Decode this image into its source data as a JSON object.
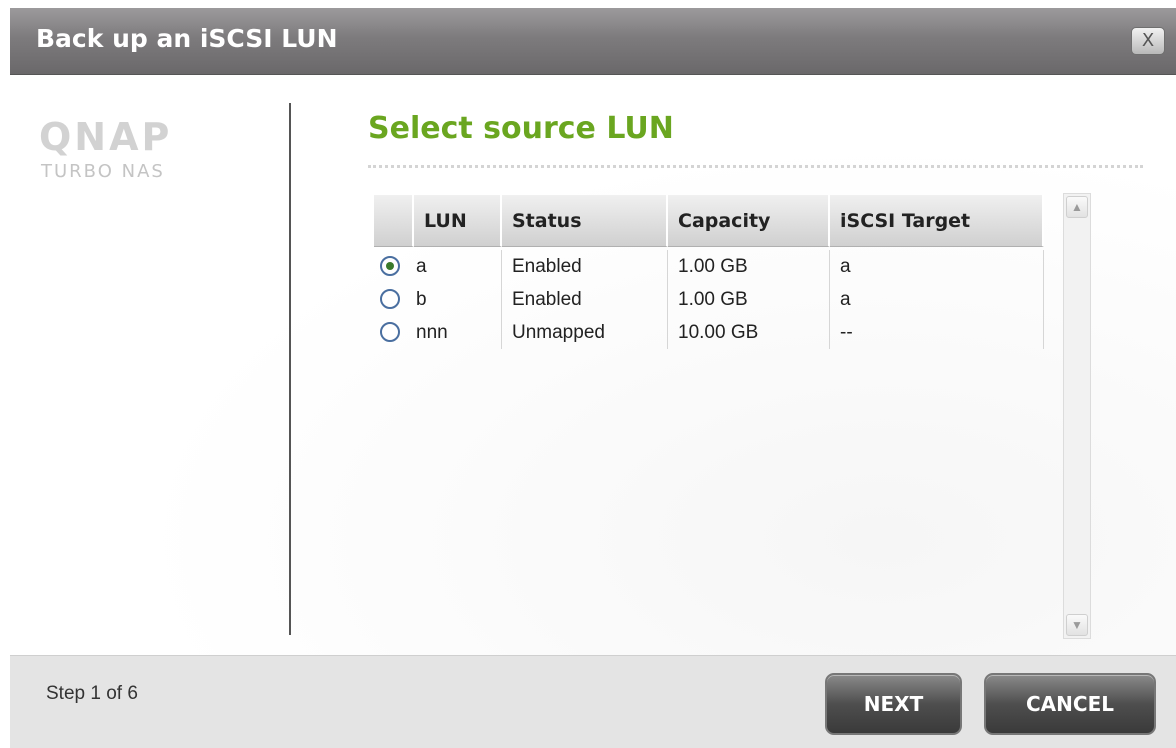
{
  "window": {
    "title": "Back up an iSCSI LUN",
    "close_label": "X"
  },
  "logo": {
    "wordmark": "QNAP",
    "tagline": "TURBO NAS"
  },
  "main": {
    "heading": "Select source LUN"
  },
  "table": {
    "columns": [
      "LUN",
      "Status",
      "Capacity",
      "iSCSI Target"
    ],
    "rows": [
      {
        "selected": true,
        "lun": "a",
        "status": "Enabled",
        "capacity": "1.00 GB",
        "target": "a"
      },
      {
        "selected": false,
        "lun": "b",
        "status": "Enabled",
        "capacity": "1.00 GB",
        "target": "a"
      },
      {
        "selected": false,
        "lun": "nnn",
        "status": "Unmapped",
        "capacity": "10.00 GB",
        "target": "--"
      }
    ]
  },
  "scrollbar": {
    "up_icon": "▲",
    "down_icon": "▼"
  },
  "footer": {
    "step_text": "Step 1 of 6",
    "next_label": "NEXT",
    "cancel_label": "CANCEL"
  },
  "colors": {
    "heading_green": "#6aa620",
    "titlebar_gray": "#7d7b7d",
    "footer_gray": "#e4e4e4"
  }
}
